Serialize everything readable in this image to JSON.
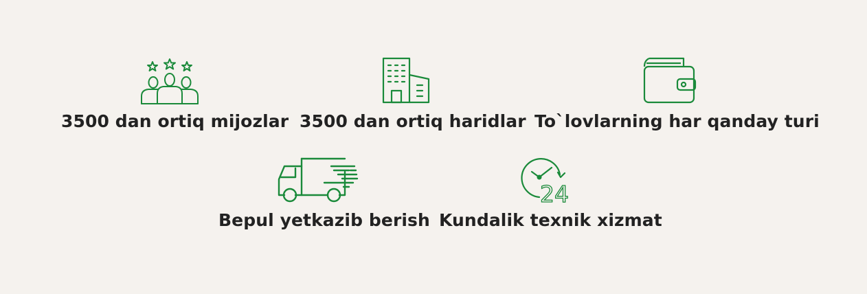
{
  "colors": {
    "background": "#f5f2ee",
    "icon_green": "#1a8a3a",
    "text": "#222222"
  },
  "features": [
    {
      "icon": "customers-stars-icon",
      "label": "3500 dan ortiq mijozlar"
    },
    {
      "icon": "buildings-icon",
      "label": "3500 dan ortiq haridlar"
    },
    {
      "icon": "wallet-icon",
      "label": "To`lovlarning har qanday turi"
    },
    {
      "icon": "delivery-truck-icon",
      "label": "Bepul yetkazib berish"
    },
    {
      "icon": "clock-24-icon",
      "label": "Kundalik texnik xizmat"
    }
  ]
}
